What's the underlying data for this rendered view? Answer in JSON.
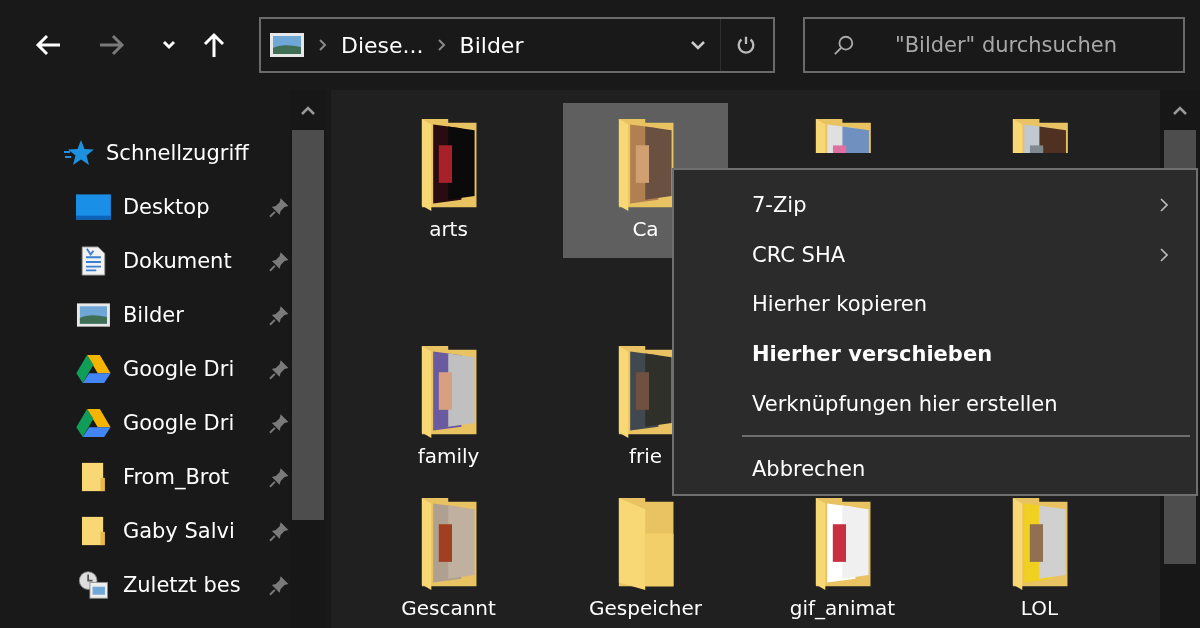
{
  "toolbar": {
    "back_disabled": false,
    "forward_disabled": true,
    "breadcrumbs": [
      "Diese...",
      "Bilder"
    ],
    "search": {
      "placeholder": "\"Bilder\" durchsuchen"
    }
  },
  "sidebar": {
    "items": [
      {
        "label": "Schnellzugriff",
        "kind": "quick-access",
        "pinned": false,
        "children": [
          {
            "label": "Desktop",
            "kind": "desktop",
            "pinned": true
          },
          {
            "label": "Dokument",
            "kind": "documents",
            "pinned": true
          },
          {
            "label": "Bilder",
            "kind": "pictures",
            "pinned": true
          },
          {
            "label": "Google Dri",
            "kind": "drive",
            "pinned": true
          },
          {
            "label": "Google Dri",
            "kind": "drive",
            "pinned": true
          },
          {
            "label": "From_Brot",
            "kind": "folder",
            "pinned": true
          },
          {
            "label": "Gaby Salvi",
            "kind": "folder",
            "pinned": true
          },
          {
            "label": "Zuletzt bes",
            "kind": "recent",
            "pinned": true
          }
        ]
      }
    ]
  },
  "folders": [
    {
      "name": "arts",
      "kind": "photos",
      "selected": false
    },
    {
      "name": "Ca",
      "kind": "photos",
      "selected": true
    },
    {
      "kind": "photos",
      "selected": false
    },
    {
      "kind": "photos",
      "selected": false
    },
    {
      "name": "family",
      "kind": "photos",
      "selected": false
    },
    {
      "name": "frie",
      "kind": "photos",
      "selected": false
    },
    {
      "kind": "none"
    },
    {
      "kind": "none"
    },
    {
      "name": "Gescannt",
      "kind": "photos",
      "selected": false
    },
    {
      "name": "Gespeicher",
      "kind": "empty",
      "selected": false
    },
    {
      "name": "gif_animat",
      "kind": "photos",
      "selected": false
    },
    {
      "name": "LOL",
      "kind": "photos",
      "selected": false
    }
  ],
  "context_menu": {
    "items": [
      {
        "label": "7-Zip",
        "kind": "submenu",
        "bold": false
      },
      {
        "label": "CRC SHA",
        "kind": "submenu",
        "bold": false
      },
      {
        "label": "Hierher kopieren",
        "kind": "action",
        "bold": false
      },
      {
        "label": "Hierher verschieben",
        "kind": "action",
        "bold": true
      },
      {
        "label": "Verknüpfungen hier erstellen",
        "kind": "action",
        "bold": false
      },
      {
        "kind": "separator"
      },
      {
        "label": "Abbrechen",
        "kind": "action",
        "bold": false
      }
    ]
  }
}
